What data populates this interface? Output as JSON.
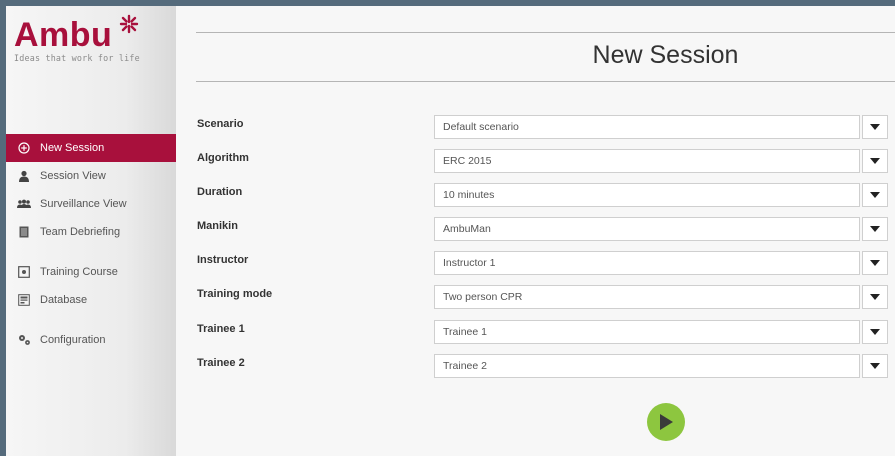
{
  "brand": {
    "name": "Ambu",
    "tagline": "Ideas that work for life",
    "color": "#a8103c"
  },
  "nav": {
    "items": [
      {
        "label": "New Session",
        "icon": "plus-circle-icon",
        "active": true
      },
      {
        "label": "Session View",
        "icon": "person-icon",
        "active": false
      },
      {
        "label": "Surveillance View",
        "icon": "group-icon",
        "active": false
      },
      {
        "label": "Team Debriefing",
        "icon": "document-icon",
        "active": false
      },
      {
        "label": "Training Course",
        "icon": "target-square-icon",
        "active": false
      },
      {
        "label": "Database",
        "icon": "database-icon",
        "active": false
      },
      {
        "label": "Configuration",
        "icon": "gears-icon",
        "active": false
      }
    ]
  },
  "page": {
    "title": "New Session"
  },
  "form": {
    "fields": [
      {
        "label": "Scenario",
        "value": "Default scenario"
      },
      {
        "label": "Algorithm",
        "value": "ERC 2015"
      },
      {
        "label": "Duration",
        "value": "10 minutes"
      },
      {
        "label": "Manikin",
        "value": "AmbuMan"
      },
      {
        "label": "Instructor",
        "value": "Instructor 1"
      },
      {
        "label": "Training mode",
        "value": "Two person CPR"
      },
      {
        "label": "Trainee 1",
        "value": "Trainee 1"
      },
      {
        "label": "Trainee 2",
        "value": "Trainee 2"
      }
    ],
    "start_icon": "play-icon",
    "start_color": "#8dc63f"
  }
}
